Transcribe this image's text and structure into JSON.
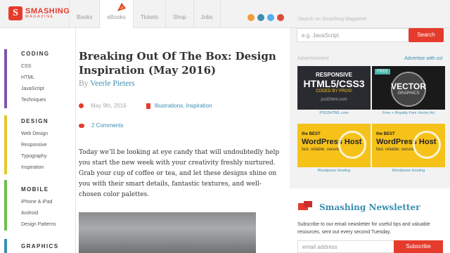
{
  "brand": {
    "name": "SMASHING",
    "sub": "MAGAZINE",
    "badge": "S"
  },
  "nav": [
    "Books",
    "eBooks",
    "Tickets",
    "Shop",
    "Jobs"
  ],
  "social": [
    "rss",
    "facebook",
    "twitter",
    "google-plus"
  ],
  "search": {
    "label": "Search on Smashing Magazine",
    "placeholder": "e.g. JavaScript",
    "button": "Search"
  },
  "sidebar": [
    {
      "heading": "CODING",
      "color": "#7b58a8",
      "links": [
        "CSS",
        "HTML",
        "JavaScript",
        "Techniques"
      ]
    },
    {
      "heading": "DESIGN",
      "color": "#e6c82e",
      "links": [
        "Web Design",
        "Responsive",
        "Typography",
        "Inspiration"
      ]
    },
    {
      "heading": "MOBILE",
      "color": "#6fbf4a",
      "links": [
        "iPhone & iPad",
        "Android",
        "Design Patterns"
      ]
    },
    {
      "heading": "GRAPHICS",
      "color": "#3b8eb1",
      "links": []
    }
  ],
  "article": {
    "title": "Breaking Out Of The Box: Design Inspiration (May 2016)",
    "by": "By",
    "author": "Veerle Pieters",
    "date": "May 9th, 2016",
    "tags": "Illustrations, Inspiration",
    "comments": "2 Comments",
    "intro": "Today we’ll be looking at eye candy that will undoubtedly help you start the new week with your creativity freshly nurtured. Grab your cup of coffee or tea, and let these designs shine on you with their smart details, fantastic textures, and well-chosen color palettes."
  },
  "ads": {
    "label": "Advertisement",
    "link": "Advertise with us!",
    "items": [
      {
        "line1": "RESPONSIVE",
        "line2": "HTML5/CSS3",
        "line3": "CODED BY PROS!",
        "line4": "psd2html.com",
        "caption": "PSD2HTML.com"
      },
      {
        "line1": "FREE",
        "line2": "VECTOR",
        "line3": "GRAPHICS",
        "caption": "Free + Royalty Free Vector Art"
      },
      {
        "small": "the BEST",
        "title": "WordPress Host",
        "sub": "fast. reliable. secure.",
        "caption": "Wordpress Hosting"
      },
      {
        "small": "the BEST",
        "title": "WordPress Host",
        "sub": "fast. reliable. secure.",
        "caption": "Wordpress Hosting"
      }
    ]
  },
  "newsletter": {
    "title": "Smashing Newsletter",
    "text": "Subscribe to our email newsletter for useful tips and valuable resources, sent out every second Tuesday.",
    "placeholder": "email address",
    "button": "Subscribe"
  }
}
